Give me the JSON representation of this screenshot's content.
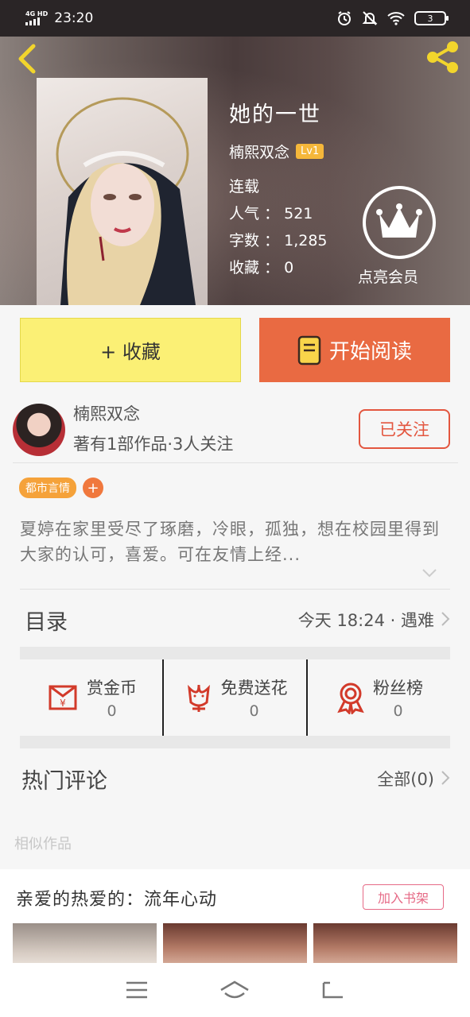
{
  "status_bar": {
    "network": "4G HD",
    "time": "23:20",
    "battery": "3"
  },
  "book": {
    "title": "她的一世",
    "author": "楠熙双念",
    "level": "Lv1",
    "status": "连载",
    "popularity_label": "人气",
    "popularity": "521",
    "words_label": "字数",
    "words": "1,285",
    "favorites_label": "收藏",
    "favorites": "0"
  },
  "vip": {
    "label": "点亮会员"
  },
  "actions": {
    "collect_label": "+ 收藏",
    "read_label": "开始阅读"
  },
  "author_section": {
    "name": "楠熙双念",
    "stats": "著有1部作品·3人关注",
    "follow_label": "已关注"
  },
  "tags": [
    "都市言情"
  ],
  "tag_add": "+",
  "description": "夏婷在家里受尽了琢磨，冷眼，孤独，想在校园里得到大家的认可，喜爱。可在友情上经...",
  "catalog": {
    "label": "目录",
    "latest": "今天 18:24 · 遇难"
  },
  "rewards": [
    {
      "icon": "red-envelope-icon",
      "label": "赏金币",
      "value": "0"
    },
    {
      "icon": "flower-icon",
      "label": "免费送花",
      "value": "0"
    },
    {
      "icon": "medal-icon",
      "label": "粉丝榜",
      "value": "0"
    }
  ],
  "comments": {
    "label": "热门评论",
    "all": "全部(0)"
  },
  "similar": {
    "label": "相似作品"
  },
  "recommendation": {
    "title": "亲爱的热爱的：流年心动",
    "add_shelf": "加入书架"
  },
  "colors": {
    "accent_orange": "#e96a42",
    "collect_yellow": "#fbf075",
    "follow_red": "#e3563f",
    "tag_orange": "#f5a23a",
    "shelf_pink": "#e66a86",
    "icon_red": "#d23a2a"
  }
}
